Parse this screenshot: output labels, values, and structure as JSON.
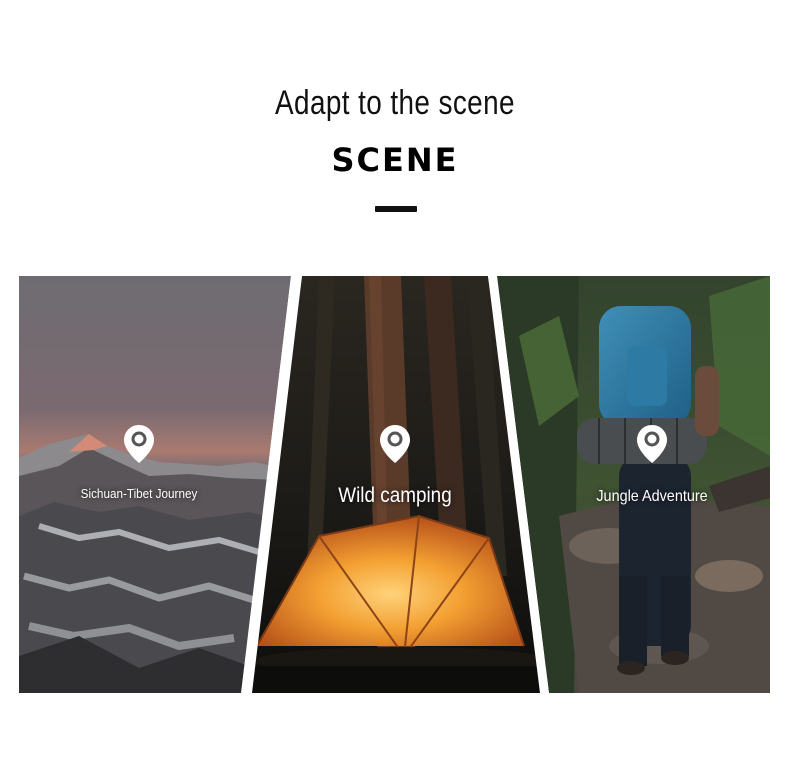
{
  "header": {
    "title": "Adapt to the scene",
    "subtitle": "SCENE"
  },
  "scenes": [
    {
      "label": "Sichuan-Tibet Journey",
      "icon": "location-pin-icon"
    },
    {
      "label": "Wild camping",
      "icon": "location-pin-icon"
    },
    {
      "label": "Jungle Adventure",
      "icon": "location-pin-icon"
    }
  ]
}
